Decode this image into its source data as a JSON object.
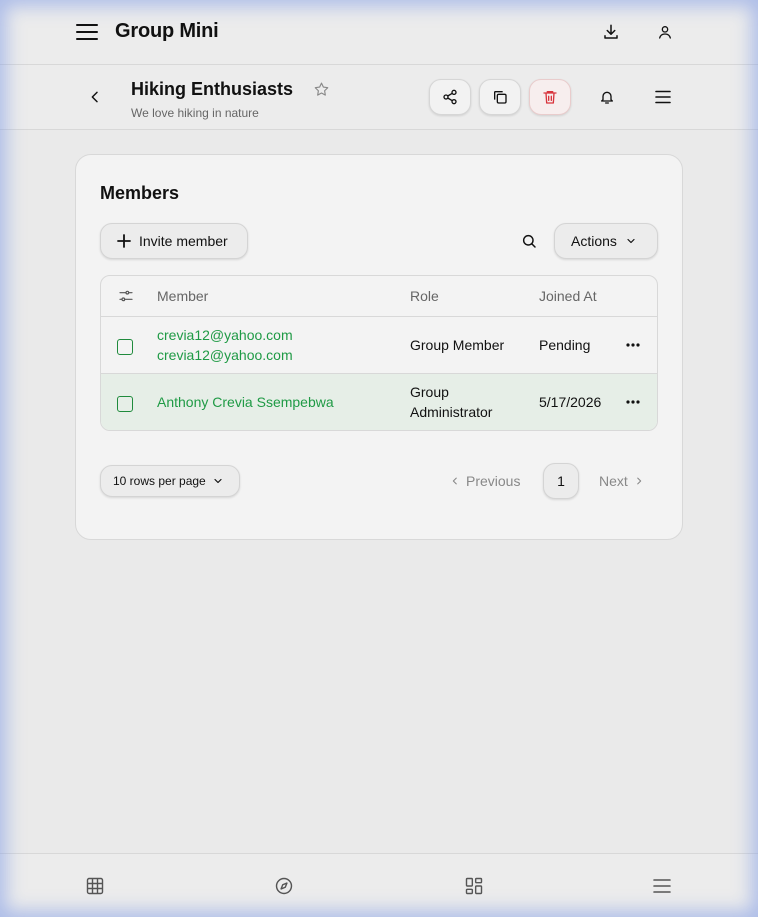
{
  "app": {
    "title": "Group Mini"
  },
  "group": {
    "name": "Hiking Enthusiasts",
    "description": "We love hiking in nature"
  },
  "members": {
    "title": "Members",
    "invite_label": "Invite member",
    "actions_label": "Actions",
    "columns": {
      "member": "Member",
      "role": "Role",
      "joined": "Joined At"
    },
    "rows": [
      {
        "member_line1": "crevia12@yahoo.com",
        "member_line2": "crevia12@yahoo.com",
        "role": "Group Member",
        "joined": "Pending"
      },
      {
        "member_line1": "Anthony Crevia Ssempebwa",
        "role_line1": "Group",
        "role_line2": "Administrator",
        "joined": "5/17/2026"
      }
    ]
  },
  "pagination": {
    "rows_per_page": "10 rows per page",
    "previous": "Previous",
    "current_page": "1",
    "next": "Next"
  },
  "colors": {
    "accent_green": "#1f9a45",
    "danger_red": "#d8343d"
  },
  "icons": [
    "hamburger-icon",
    "download-icon",
    "user-icon",
    "back-icon",
    "star-icon",
    "share-icon",
    "copy-icon",
    "trash-icon",
    "bell-icon",
    "menu-icon",
    "plus-icon",
    "search-icon",
    "chevron-down-icon",
    "column-settings-icon",
    "more-icon",
    "chevron-left-icon",
    "chevron-right-icon",
    "table-icon",
    "compass-icon",
    "dashboard-icon"
  ]
}
